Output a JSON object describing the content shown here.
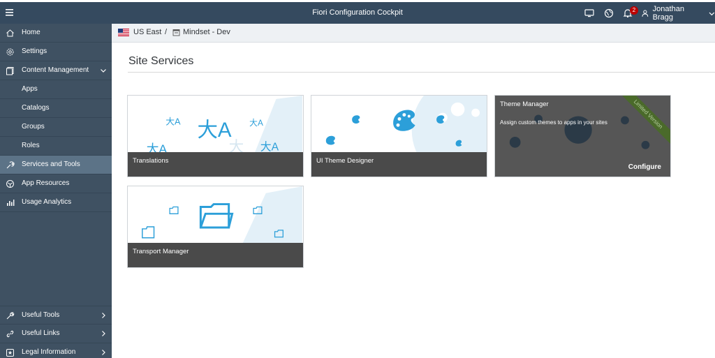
{
  "header": {
    "title": "Fiori Configuration Cockpit",
    "notification_count": "2",
    "user_name": "Jonathan Bragg",
    "icons": [
      "menu-icon",
      "monitor-icon",
      "globe-icon",
      "bell-icon",
      "user-icon",
      "chevron-down-icon"
    ]
  },
  "sidebar": {
    "items": [
      {
        "label": "Home",
        "icon": "home-icon"
      },
      {
        "label": "Settings",
        "icon": "gear-icon"
      },
      {
        "label": "Content Management",
        "icon": "content-icon"
      },
      {
        "label": "Apps"
      },
      {
        "label": "Catalogs"
      },
      {
        "label": "Groups"
      },
      {
        "label": "Roles"
      },
      {
        "label": "Services and Tools",
        "icon": "tools-icon",
        "selected": true
      },
      {
        "label": "App Resources",
        "icon": "resources-icon"
      },
      {
        "label": "Usage Analytics",
        "icon": "analytics-icon"
      }
    ],
    "bottom_items": [
      {
        "label": "Useful Tools",
        "icon": "wrench-icon"
      },
      {
        "label": "Useful Links",
        "icon": "link-icon"
      },
      {
        "label": "Legal Information",
        "icon": "legal-icon"
      }
    ]
  },
  "breadcrumb": {
    "region": "US East",
    "separator": "/",
    "site": "Mindset - Dev"
  },
  "page": {
    "title": "Site Services"
  },
  "tiles": [
    {
      "name": "Translations"
    },
    {
      "name": "UI Theme Designer"
    },
    {
      "name": "Theme Manager",
      "description": "Assign custom themes to apps in your sites",
      "action": "Configure",
      "ribbon": "Limited Version"
    },
    {
      "name": "Transport Manager"
    }
  ],
  "colors": {
    "shell": "#354a5f",
    "sidebar": "#3f5162",
    "selected": "#5c7387",
    "accent": "#2c9fd9",
    "badge": "#bb0000"
  }
}
